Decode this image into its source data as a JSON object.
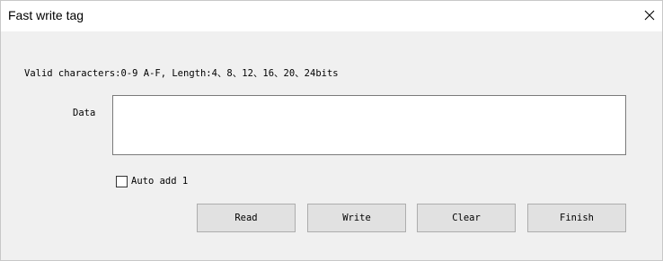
{
  "window": {
    "title": "Fast write tag",
    "close_icon": "close-icon"
  },
  "form": {
    "info": "Valid characters:0-9 A-F, Length:4、8、12、16、20、24bits",
    "data_label": "Data",
    "data_value": "",
    "auto_add_label": "Auto add 1",
    "auto_add_checked": false
  },
  "buttons": {
    "read": "Read",
    "write": "Write",
    "clear": "Clear",
    "finish": "Finish"
  }
}
